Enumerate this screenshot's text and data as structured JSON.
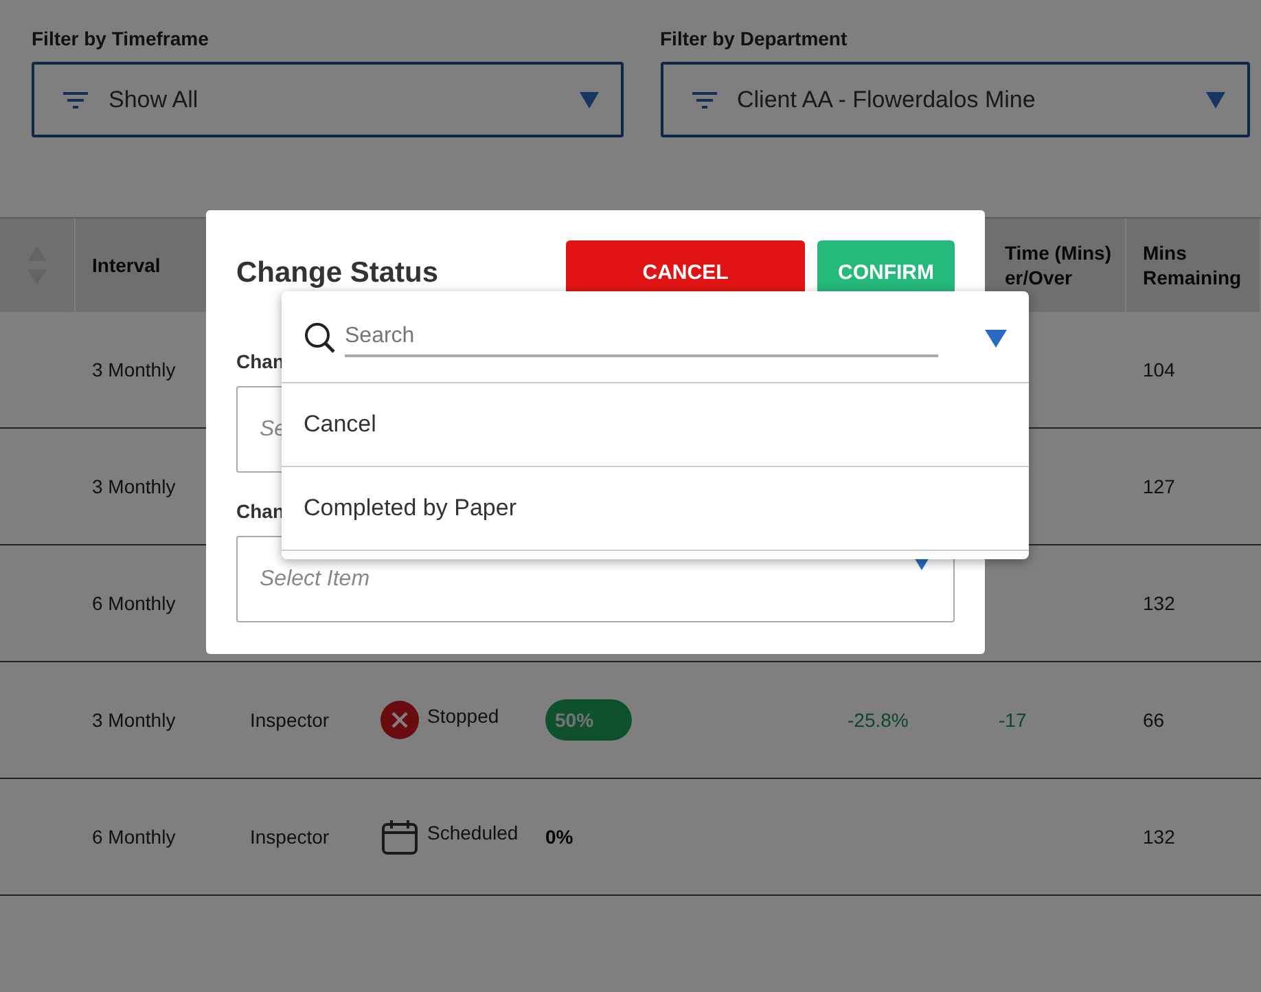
{
  "filters": [
    {
      "label": "Filter by Timeframe",
      "value": "Show All"
    },
    {
      "label": "Filter by Department",
      "value": "Client AA - Flowerdalos Mine"
    }
  ],
  "table": {
    "header": {
      "interval": "Interval",
      "time_under_over": "Time (Mins)\ner/Over",
      "mins_remaining": "Mins Remaining"
    },
    "rows": [
      {
        "interval": "3 Monthly",
        "mins_remaining": "104"
      },
      {
        "interval": "3 Monthly",
        "mins_remaining": "127"
      },
      {
        "interval": "6 Monthly",
        "mins_remaining": "132"
      },
      {
        "interval": "3 Monthly",
        "role": "Inspector",
        "status": {
          "kind": "stopped",
          "label": "Stopped"
        },
        "progress": {
          "kind": "pill",
          "label": "50%"
        },
        "variance": "-25.8%",
        "difference": "-17",
        "mins_remaining": "66"
      },
      {
        "interval": "6 Monthly",
        "role": "Inspector",
        "status": {
          "kind": "scheduled",
          "label": "Scheduled"
        },
        "progress": {
          "kind": "plain",
          "label": "0%"
        },
        "mins_remaining": "132"
      }
    ]
  },
  "dialog": {
    "title": "Change Status",
    "buttons": [
      {
        "kind": "cancel",
        "label": "CANCEL"
      },
      {
        "kind": "confirm",
        "label": "CONFIRM"
      }
    ],
    "fields": [
      {
        "label": "Chan",
        "placeholder": "Se"
      },
      {
        "label": "Chan",
        "placeholder": "Select Item"
      }
    ],
    "dropdown": {
      "search_placeholder": "Search",
      "options": [
        "Cancel",
        "Completed by Paper"
      ]
    }
  }
}
